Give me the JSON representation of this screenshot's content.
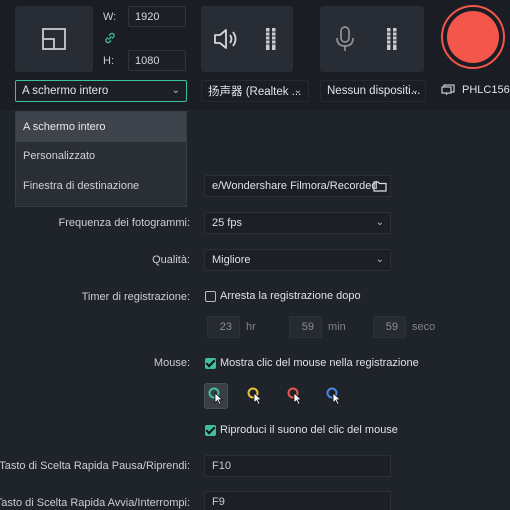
{
  "resolution": {
    "width_label": "W:",
    "width_value": "1920",
    "height_label": "H:",
    "height_value": "1080"
  },
  "area_select": {
    "selected": "A schermo intero",
    "options": [
      "A schermo intero",
      "Personalizzato",
      "Finestra di destinazione"
    ]
  },
  "speaker": {
    "selected": "扬声器 (Realtek ..."
  },
  "microphone": {
    "selected": "Nessun dispositi..."
  },
  "monitor": {
    "label": "PHLC156"
  },
  "record_button": {
    "color": "#f4564c"
  },
  "settings": {
    "save_path": {
      "value": "e/Wondershare Filmora/Recorded"
    },
    "frame_rate": {
      "label": "Frequenza dei fotogrammi:",
      "value": "25 fps"
    },
    "quality": {
      "label": "Qualità:",
      "value": "Migliore"
    },
    "timer": {
      "label": "Timer di registrazione:",
      "checkbox_label": "Arresta la registrazione dopo",
      "checked": false,
      "hours": "23",
      "hours_unit": "hr",
      "minutes": "59",
      "minutes_unit": "min",
      "seconds": "59",
      "seconds_unit": "seco"
    },
    "mouse": {
      "label": "Mouse:",
      "show_clicks_label": "Mostra clic del mouse nella registrazione",
      "show_clicks_checked": true,
      "cursor_styles": [
        {
          "name": "green",
          "color": "#3fbfa0",
          "selected": true
        },
        {
          "name": "yellow",
          "color": "#e8c33a",
          "selected": false
        },
        {
          "name": "red",
          "color": "#e8584f",
          "selected": false
        },
        {
          "name": "blue",
          "color": "#4a86e8",
          "selected": false
        }
      ],
      "click_sound_label": "Riproduci il suono del clic del mouse",
      "click_sound_checked": true
    },
    "hotkey_pause": {
      "label": "Tasto di Scelta Rapida Pausa/Riprendi:",
      "value": "F10"
    },
    "hotkey_start": {
      "label": "Tasto di Scelta Rapida Avvia/Interrompi:",
      "value": "F9"
    }
  },
  "colors": {
    "accent": "#3fbfa0",
    "background": "#1f232a",
    "panel": "#282c34"
  }
}
